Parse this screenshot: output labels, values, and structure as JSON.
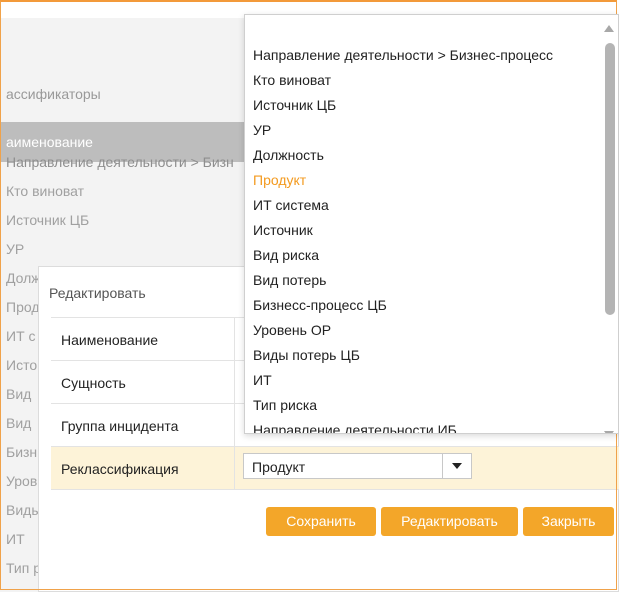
{
  "background": {
    "section_title": "ассификаторы",
    "table_header": "аименование",
    "rows": [
      "Направление деятельности > Бизн",
      "Кто виноват",
      "Источник ЦБ",
      "УР",
      "Долж",
      "Прод",
      "ИТ с",
      "Исто",
      "Вид",
      "Вид",
      "Бизн",
      "Уров",
      "Виды",
      "ИТ",
      "Тип р"
    ]
  },
  "modal": {
    "title": "Редактировать",
    "fields": [
      {
        "label": "Наименование",
        "value": ""
      },
      {
        "label": "Сущность",
        "value": ""
      },
      {
        "label": "Группа инцидента",
        "value": ""
      },
      {
        "label": "Реклассификация",
        "value": "Продукт"
      }
    ],
    "buttons": {
      "save": "Сохранить",
      "edit": "Редактировать",
      "close": "Закрыть"
    }
  },
  "dropdown": {
    "selected": "Продукт",
    "options": [
      "Направление деятельности > Бизнес-процесс",
      "Кто виноват",
      "Источник ЦБ",
      "УР",
      "Должность",
      "Продукт",
      "ИТ система",
      "Источник",
      "Вид риска",
      "Вид потерь",
      "Бизнесс-процесс ЦБ",
      "Уровень ОР",
      "Виды потерь ЦБ",
      "ИТ",
      "Тип риска",
      "Направление деятельности ИБ"
    ]
  },
  "colors": {
    "accent": "#f3a629",
    "selected_text": "#f39a1f",
    "highlight_row": "#fdf3d8"
  },
  "icons": {
    "dropdown_caret": "chevron-down-icon",
    "scroll_up": "arrow-up-icon",
    "scroll_down": "arrow-down-icon"
  }
}
